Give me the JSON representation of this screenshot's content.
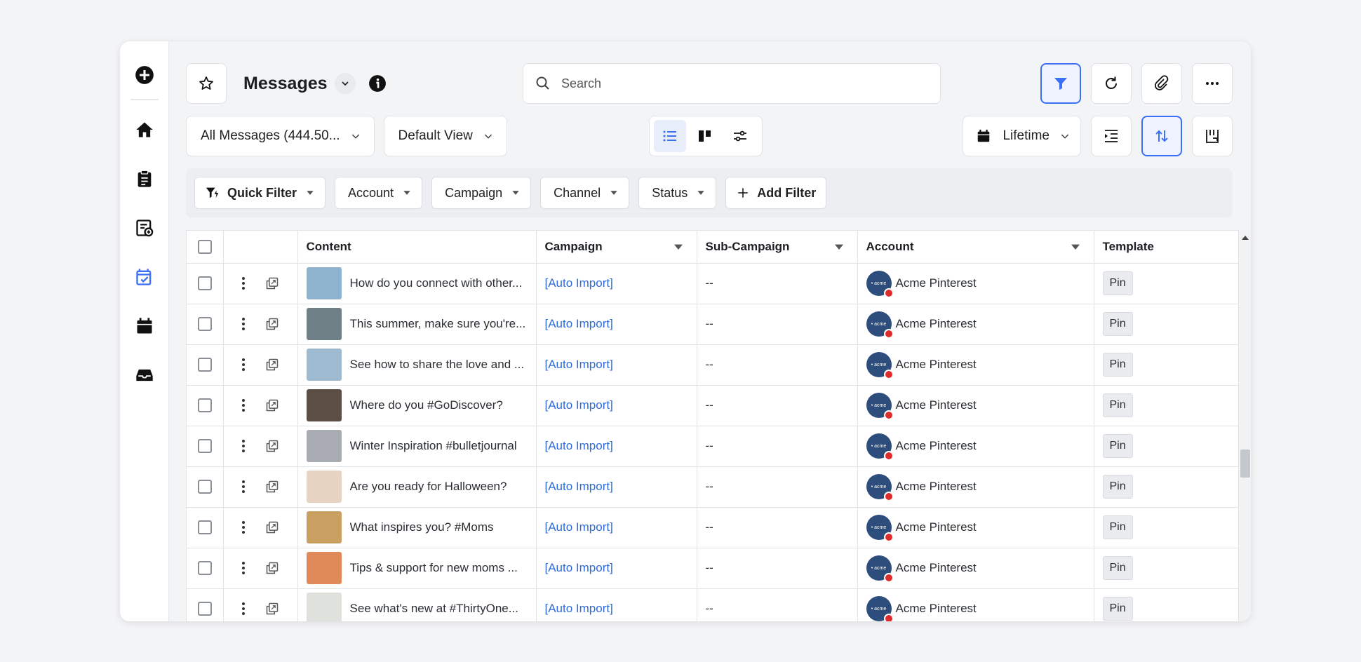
{
  "header": {
    "title": "Messages",
    "search_placeholder": "Search"
  },
  "toolbar": {
    "all_messages": "All Messages (444.50...",
    "default_view": "Default View",
    "date_range": "Lifetime"
  },
  "filters": {
    "quick_filter": "Quick Filter",
    "account": "Account",
    "campaign": "Campaign",
    "channel": "Channel",
    "status": "Status",
    "add_filter": "Add Filter"
  },
  "table": {
    "columns": [
      "Content",
      "Campaign",
      "Sub-Campaign",
      "Account",
      "Template"
    ],
    "rows": [
      {
        "content": "How do you connect with other...",
        "campaign": "[Auto Import]",
        "sub": "--",
        "account": "Acme Pinterest",
        "template": "Pin",
        "thumb": "#8eb3cf"
      },
      {
        "content": "This summer, make sure you're...",
        "campaign": "[Auto Import]",
        "sub": "--",
        "account": "Acme Pinterest",
        "template": "Pin",
        "thumb": "#6f7f86"
      },
      {
        "content": "See how to share the love and ...",
        "campaign": "[Auto Import]",
        "sub": "--",
        "account": "Acme Pinterest",
        "template": "Pin",
        "thumb": "#9fbbd2"
      },
      {
        "content": "Where do you #GoDiscover?",
        "campaign": "[Auto Import]",
        "sub": "--",
        "account": "Acme Pinterest",
        "template": "Pin",
        "thumb": "#5c4e44"
      },
      {
        "content": "Winter Inspiration #bulletjournal",
        "campaign": "[Auto Import]",
        "sub": "--",
        "account": "Acme Pinterest",
        "template": "Pin",
        "thumb": "#a9adb3"
      },
      {
        "content": "Are you ready for Halloween?",
        "campaign": "[Auto Import]",
        "sub": "--",
        "account": "Acme Pinterest",
        "template": "Pin",
        "thumb": "#e7d3c2"
      },
      {
        "content": "What inspires you? #Moms",
        "campaign": "[Auto Import]",
        "sub": "--",
        "account": "Acme Pinterest",
        "template": "Pin",
        "thumb": "#c9a062"
      },
      {
        "content": "Tips & support for new moms ...",
        "campaign": "[Auto Import]",
        "sub": "--",
        "account": "Acme Pinterest",
        "template": "Pin",
        "thumb": "#e08a5a"
      },
      {
        "content": "See what's new at #ThirtyOne...",
        "campaign": "[Auto Import]",
        "sub": "--",
        "account": "Acme Pinterest",
        "template": "Pin",
        "thumb": "#dfe1dc"
      }
    ]
  },
  "colors": {
    "accent": "#3b6ff5",
    "link": "#2f6bd9",
    "avatar": "#2d4d7c",
    "badge": "#e02b2b"
  }
}
